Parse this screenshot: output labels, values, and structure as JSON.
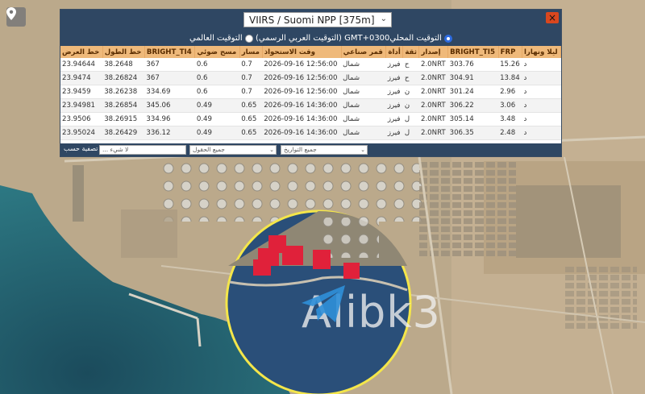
{
  "header": {
    "satellite_select": "VIIRS / Suomi NPP [375m]",
    "close_label": "×"
  },
  "timezone": {
    "local_label": "التوقيت المحلي",
    "official_label": "(التوقيت العربي الرسمي) GMT+0300",
    "world_label": "التوقيت العالمي"
  },
  "table": {
    "columns": [
      "خط العرض",
      "خط الطول",
      "BRIGHT_TI4",
      "مسح ضوئي",
      "مسار",
      "وقت الاستحواذ",
      "قمر صناعي",
      "أداة",
      "ثقة",
      "إصدار",
      "BRIGHT_TI5",
      "FRP",
      "ليلا ونهارا"
    ],
    "rows": [
      [
        "23.94644",
        "38.2648",
        "367",
        "0.6",
        "0.7",
        "2026-09-16 12:56:00",
        "شمال",
        "فيرز",
        "ح",
        "2.0NRT",
        "303.76",
        "15.26",
        "د"
      ],
      [
        "23.9474",
        "38.26824",
        "367",
        "0.6",
        "0.7",
        "2026-09-16 12:56:00",
        "شمال",
        "فيرز",
        "ح",
        "2.0NRT",
        "304.91",
        "13.84",
        "د"
      ],
      [
        "23.9459",
        "38.26238",
        "334.69",
        "0.6",
        "0.7",
        "2026-09-16 12:56:00",
        "شمال",
        "فيرز",
        "ن",
        "2.0NRT",
        "301.24",
        "2.96",
        "د"
      ],
      [
        "23.94981",
        "38.26854",
        "345.06",
        "0.49",
        "0.65",
        "2026-09-16 14:36:00",
        "شمال",
        "فيرز",
        "ن",
        "2.0NRT",
        "306.22",
        "3.06",
        "د"
      ],
      [
        "23.9506",
        "38.26915",
        "334.96",
        "0.49",
        "0.65",
        "2026-09-16 14:36:00",
        "شمال",
        "فيرز",
        "ل",
        "2.0NRT",
        "305.14",
        "3.48",
        "د"
      ],
      [
        "23.95024",
        "38.26429",
        "336.12",
        "0.49",
        "0.65",
        "2026-09-16 14:36:00",
        "شمال",
        "فيرز",
        "ل",
        "2.0NRT",
        "306.35",
        "2.48",
        "د"
      ]
    ]
  },
  "filters": {
    "label": "تصفية حسب",
    "search_placeholder": "... لا شيء",
    "fields_select": "جميع الحقول",
    "dates_select": "جميع التواريخ"
  },
  "watermark": {
    "text": "Alibk3"
  },
  "colors": {
    "header_bg": "#2f4763",
    "table_head": "#efb97a",
    "fire_marker": "#e0213a",
    "highlight_ring": "#f4e64a"
  },
  "icons": {
    "map_pin": "map-pin-icon",
    "telegram": "telegram-icon"
  }
}
